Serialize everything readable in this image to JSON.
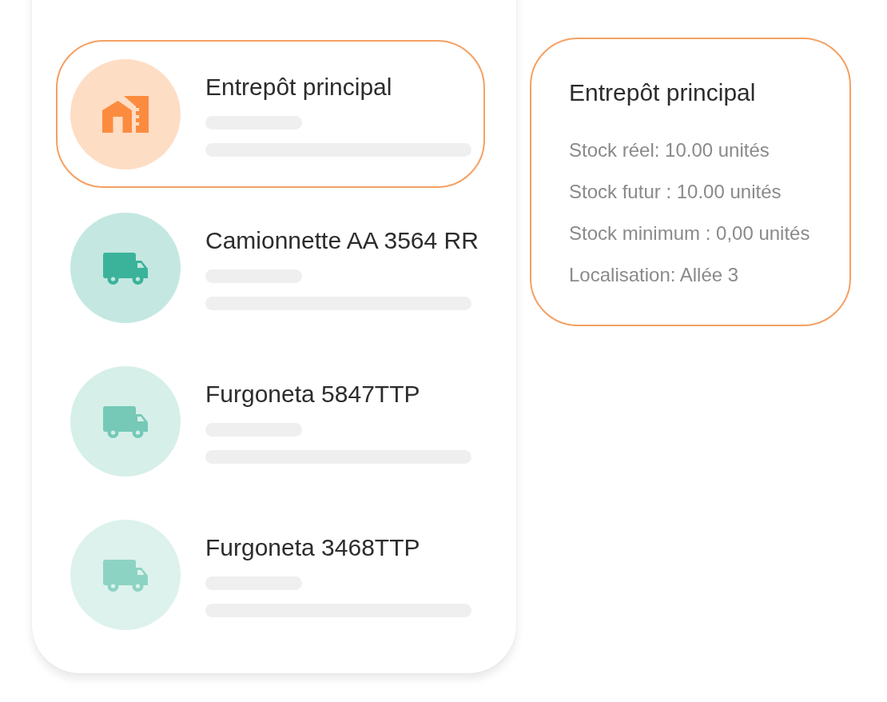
{
  "locations": [
    {
      "kind": "warehouse",
      "title": "Entrepôt principal",
      "color": "#fb8c3f",
      "selected": true
    },
    {
      "kind": "truck",
      "title": "Camionnette AA 3564 RR",
      "color": "#3bb39a",
      "selected": false
    },
    {
      "kind": "truck",
      "title": "Furgoneta 5847TTP",
      "color": "#76c9b7",
      "selected": false
    },
    {
      "kind": "truck",
      "title": "Furgoneta 3468TTP",
      "color": "#8dd3c3",
      "selected": false
    }
  ],
  "details": {
    "title": "Entrepôt principal",
    "lines": [
      "Stock réel: 10.00 unités",
      "Stock futur : 10.00 unités",
      "Stock minimum : 0,00 unités",
      "Localisation: Allée 3"
    ]
  }
}
